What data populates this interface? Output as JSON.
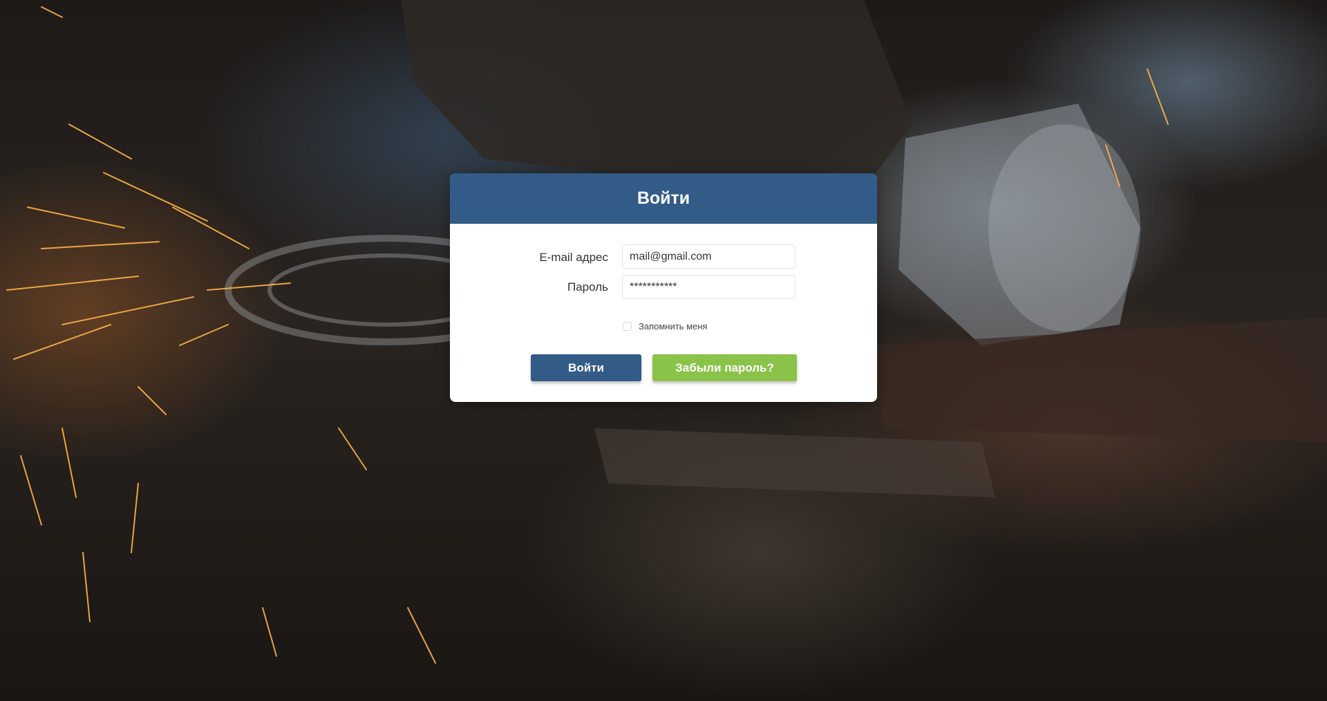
{
  "login": {
    "title": "Войти",
    "email_label": "E-mail адрес",
    "email_value": "mail@gmail.com",
    "password_label": "Пароль",
    "password_value": "***********",
    "remember_label": "Запомнить меня",
    "remember_checked": false,
    "login_button": "Войти",
    "forgot_button": "Забыли пароль?"
  },
  "colors": {
    "header_bg": "#335b88",
    "login_button_bg": "#335b88",
    "forgot_button_bg": "#8bc34a",
    "card_bg": "#ffffff"
  },
  "background": {
    "description_icon": "welding-sparks-photo"
  }
}
